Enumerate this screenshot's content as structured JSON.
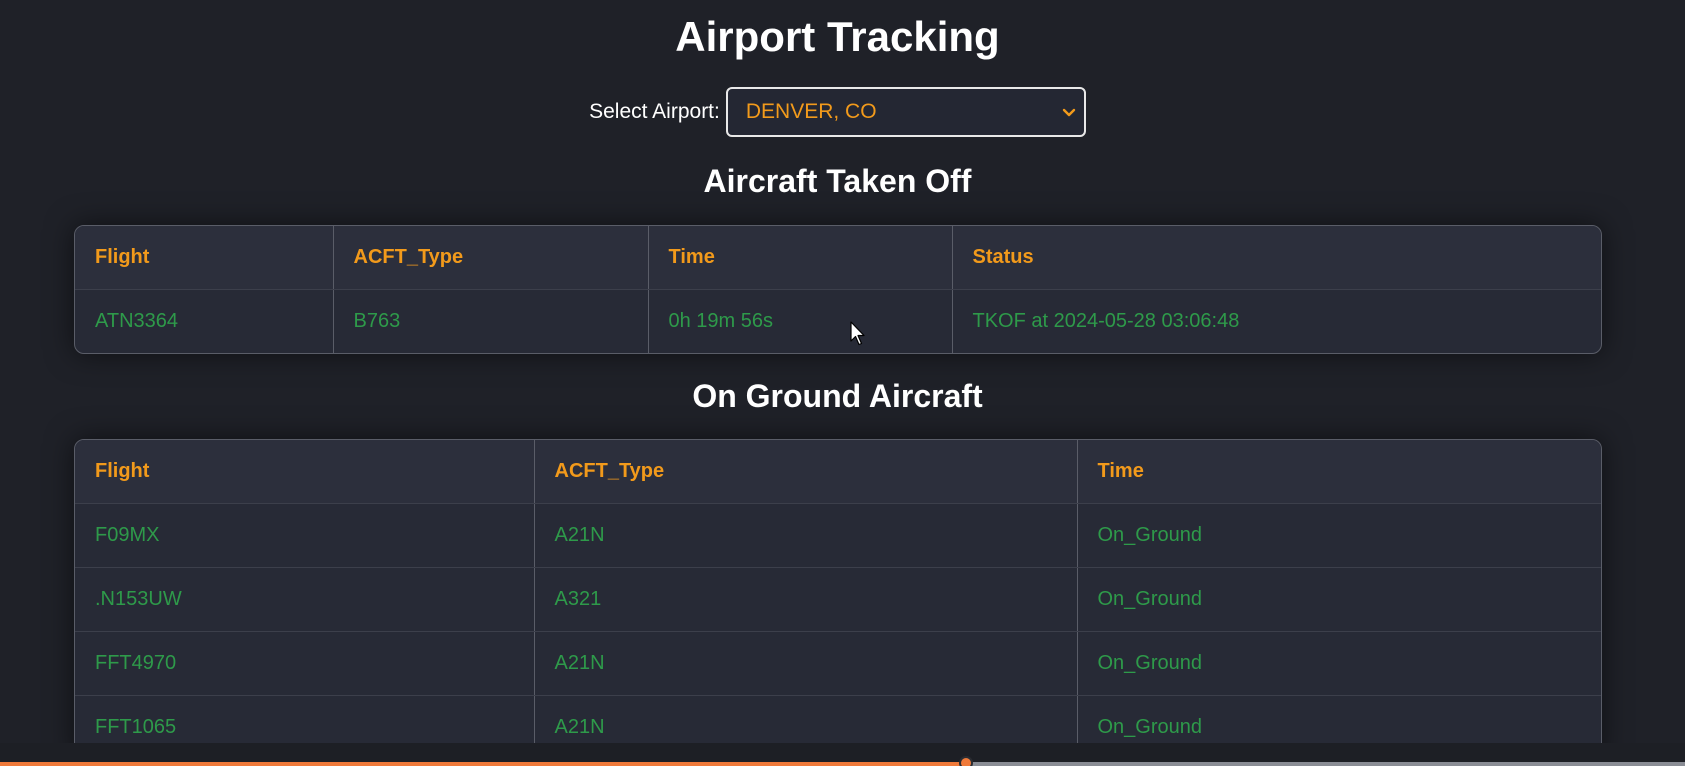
{
  "app": {
    "title": "Airport Tracking"
  },
  "selector": {
    "label": "Select Airport:",
    "selected": "DENVER, CO",
    "icon": "chevron-down-icon"
  },
  "taken_off": {
    "title": "Aircraft Taken Off",
    "headers": [
      "Flight",
      "ACFT_Type",
      "Time",
      "Status"
    ],
    "rows": [
      [
        "ATN3364",
        "B763",
        "0h 19m 56s",
        "TKOF at 2024-05-28 03:06:48"
      ]
    ]
  },
  "on_ground": {
    "title": "On Ground Aircraft",
    "headers": [
      "Flight",
      "ACFT_Type",
      "Time"
    ],
    "rows": [
      [
        "F09MX",
        "A21N",
        "On_Ground"
      ],
      [
        ".N153UW",
        "A321",
        "On_Ground"
      ],
      [
        "FFT4970",
        "A21N",
        "On_Ground"
      ],
      [
        "FFT1065",
        "A21N",
        "On_Ground"
      ]
    ]
  },
  "video_progress": {
    "fraction": 0.573
  },
  "colors": {
    "background": "#1f2128",
    "accent": "#f29a1b",
    "value_text": "#2e9a4a",
    "progress": "#f07a3a"
  }
}
